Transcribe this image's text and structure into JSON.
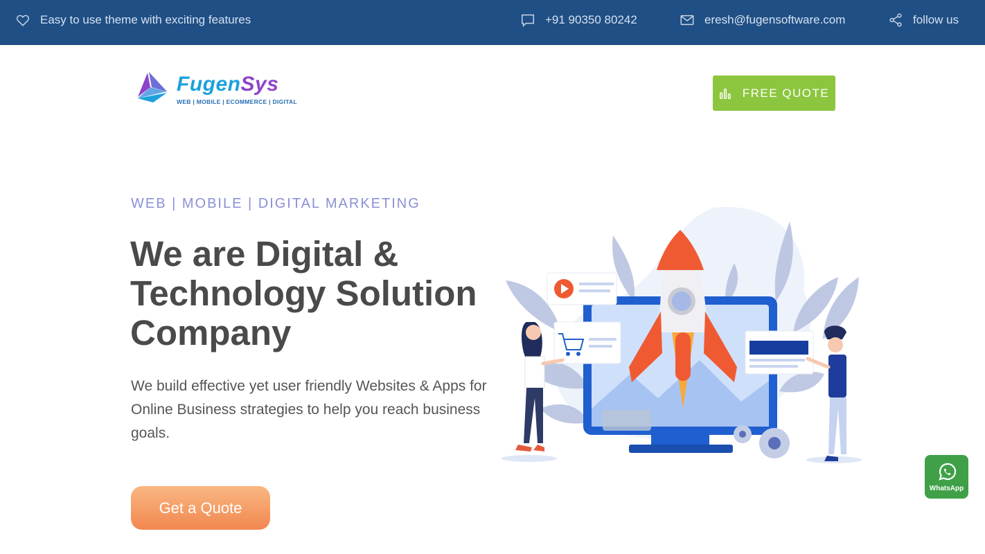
{
  "topbar": {
    "tagline": "Easy to use theme with exciting features",
    "phone": "+91 90350 80242",
    "email": "eresh@fugensoftware.com",
    "follow": "follow us",
    "icons": [
      "heart-icon",
      "chat-bubble-icon",
      "envelope-icon",
      "share-icon"
    ],
    "background": "#1f4f85"
  },
  "header": {
    "logo_name_part1": "Fugen",
    "logo_name_part2": "Sys",
    "logo_tagline": "WEB | MOBILE | ECOMMERCE | DIGITAL",
    "cta_label": "FREE QUOTE",
    "cta_icon": "bar-chart-icon",
    "cta_color": "#8cc63f"
  },
  "hero": {
    "eyebrow": "WEB | MOBILE | DIGITAL MARKETING",
    "headline": "We are Digital & Technology Solution Company",
    "subtext": "We build effective yet user friendly Websites & Apps for Online Business strategies to help you reach business goals.",
    "button_label": "Get a Quote",
    "accent_color": "#f2874f"
  },
  "whatsapp": {
    "label": "WhatsApp",
    "color": "#3fa047"
  }
}
